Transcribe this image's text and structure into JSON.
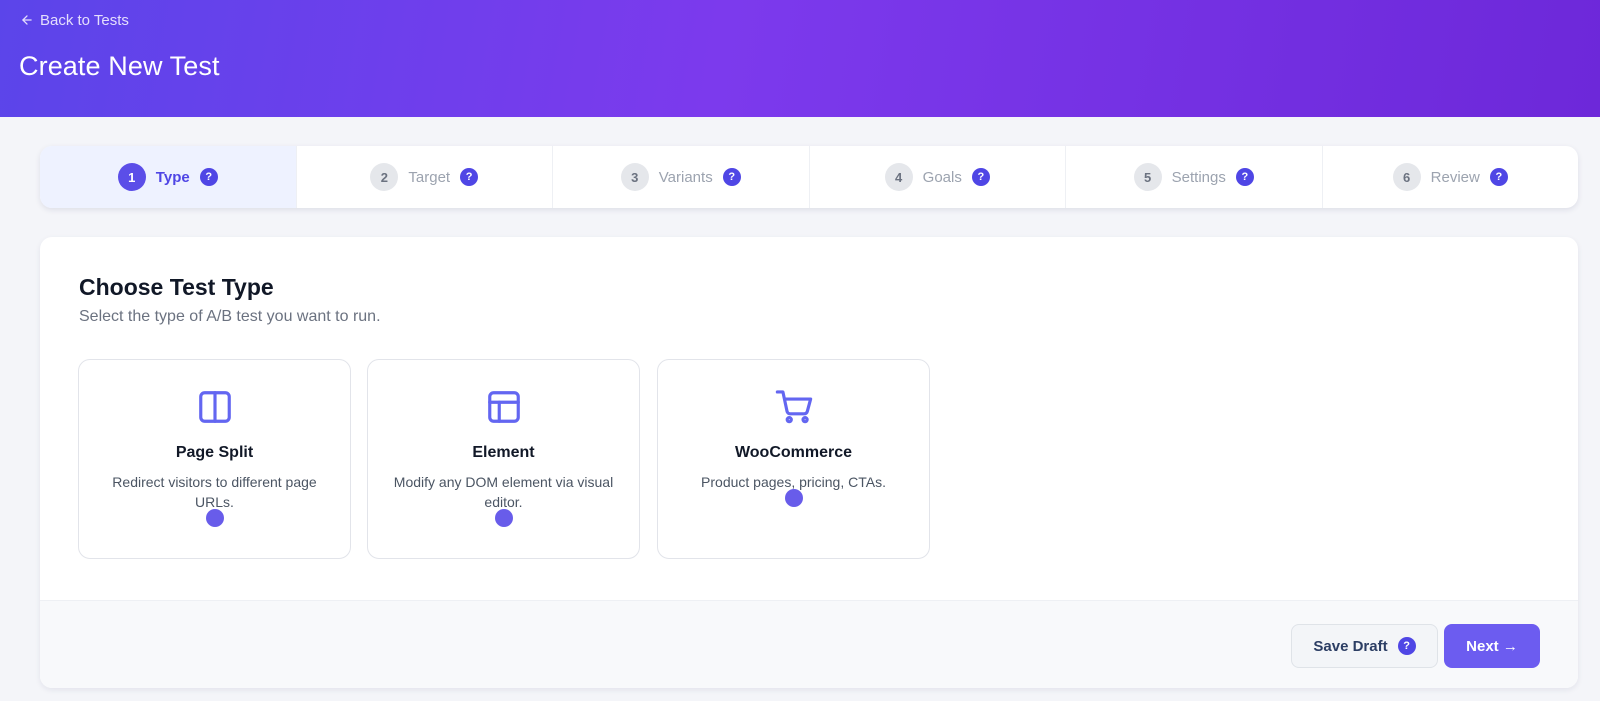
{
  "header": {
    "back_label": "Back to Tests",
    "title": "Create New Test",
    "back_icon": "arrow-left-icon"
  },
  "steps": [
    {
      "number": "1",
      "label": "Type",
      "active": true
    },
    {
      "number": "2",
      "label": "Target",
      "active": false
    },
    {
      "number": "3",
      "label": "Variants",
      "active": false
    },
    {
      "number": "4",
      "label": "Goals",
      "active": false
    },
    {
      "number": "5",
      "label": "Settings",
      "active": false
    },
    {
      "number": "6",
      "label": "Review",
      "active": false
    }
  ],
  "help_glyph": "?",
  "section": {
    "title": "Choose Test Type",
    "subtitle": "Select the type of A/B test you want to run."
  },
  "test_types": [
    {
      "icon": "split-columns-icon",
      "title": "Page Split",
      "description": "Redirect visitors to different page URLs."
    },
    {
      "icon": "layout-icon",
      "title": "Element",
      "description": "Modify any DOM element via visual editor."
    },
    {
      "icon": "shopping-cart-icon",
      "title": "WooCommerce",
      "description": "Product pages, pricing, CTAs."
    }
  ],
  "footer": {
    "save_draft_label": "Save Draft",
    "next_label": "Next →"
  },
  "colors": {
    "header_start": "#5b45ea",
    "header_end": "#6d28d9",
    "accent": "#4f46e5",
    "icon": "#6366f1",
    "next_button": "#6c5cf0"
  }
}
